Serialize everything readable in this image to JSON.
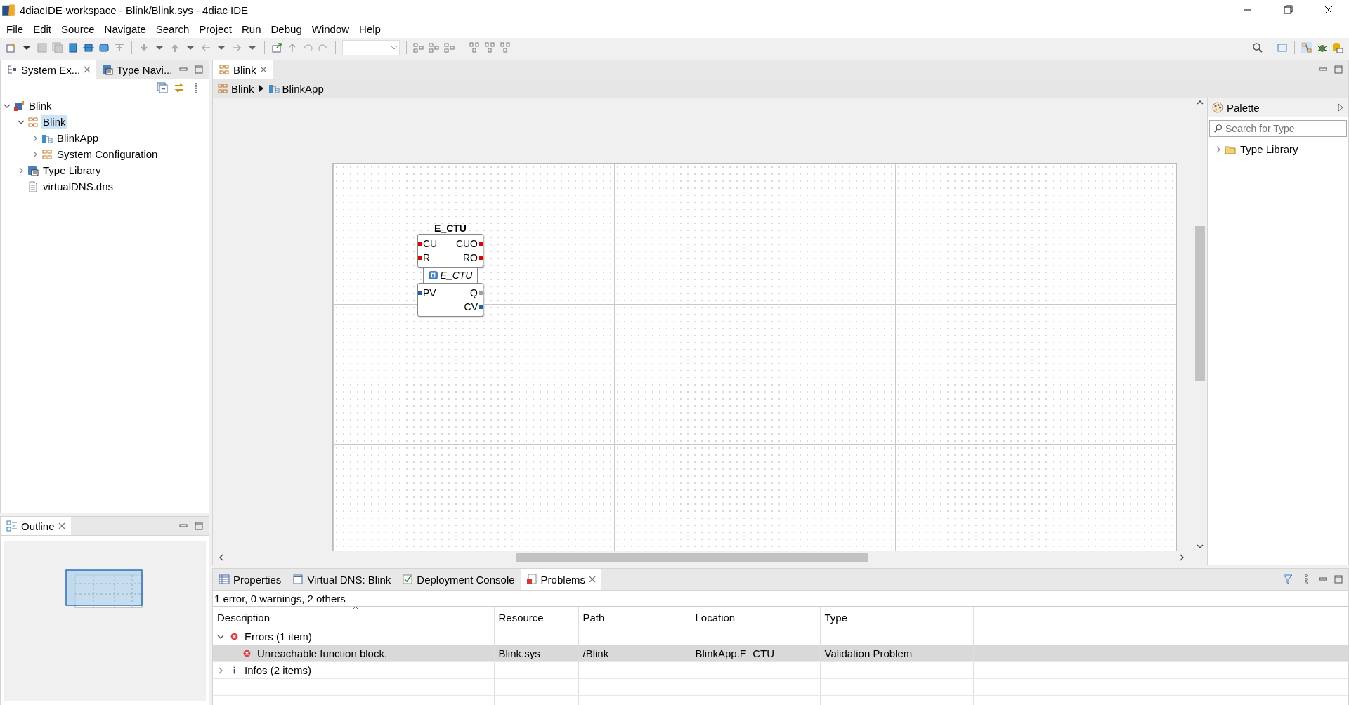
{
  "window": {
    "title": "4diacIDE-workspace - Blink/Blink.sys - 4diac IDE"
  },
  "menu": [
    "File",
    "Edit",
    "Source",
    "Navigate",
    "Search",
    "Project",
    "Run",
    "Debug",
    "Window",
    "Help"
  ],
  "left_tabs": [
    {
      "label": "System Ex...",
      "selected": true,
      "closable": true
    },
    {
      "label": "Type Navi...",
      "selected": false,
      "closable": false
    }
  ],
  "tree": [
    {
      "label": "Blink",
      "kind": "project",
      "expanded": true,
      "selected": false,
      "children": [
        {
          "label": "Blink",
          "kind": "system",
          "expanded": true,
          "selected": true,
          "children": [
            {
              "label": "BlinkApp",
              "kind": "application",
              "expanded": false,
              "selected": false
            },
            {
              "label": "System Configuration",
              "kind": "configuration",
              "expanded": false,
              "selected": false
            }
          ]
        },
        {
          "label": "Type Library",
          "kind": "library",
          "expanded": false,
          "selected": false
        },
        {
          "label": "virtualDNS.dns",
          "kind": "file",
          "selected": false
        }
      ]
    }
  ],
  "outline": {
    "tab": "Outline"
  },
  "editor": {
    "tab": "Blink",
    "breadcrumb": [
      {
        "label": "Blink",
        "kind": "system"
      },
      {
        "label": "BlinkApp",
        "kind": "application"
      }
    ],
    "block": {
      "name": "E_CTU",
      "type": "E_CTU",
      "event_inputs": [
        "CU",
        "R"
      ],
      "event_outputs": [
        "CUO",
        "RO"
      ],
      "data_inputs": [
        {
          "name": "PV",
          "color": "#1f5fa8"
        }
      ],
      "data_outputs": [
        {
          "name": "Q",
          "color": "#a0a08c"
        },
        {
          "name": "CV",
          "color": "#1f5fa8"
        }
      ]
    }
  },
  "palette": {
    "title": "Palette",
    "placeholder": "Search for Type",
    "items": [
      {
        "label": "Type Library",
        "expanded": false
      }
    ]
  },
  "bottom": {
    "tabs": [
      {
        "label": "Properties",
        "selected": false
      },
      {
        "label": "Virtual DNS: Blink",
        "selected": false
      },
      {
        "label": "Deployment Console",
        "selected": false
      },
      {
        "label": "Problems",
        "selected": true
      }
    ],
    "summary": "1 error, 0 warnings, 2 others",
    "columns": [
      "Description",
      "Resource",
      "Path",
      "Location",
      "Type"
    ],
    "rows": [
      {
        "kind": "errors",
        "expanded": true,
        "selected": false,
        "cells": [
          "Errors (1 item)"
        ]
      },
      {
        "kind": "error",
        "selected": true,
        "cells": [
          "Unreachable function block.",
          "Blink.sys",
          "/Blink",
          "BlinkApp.E_CTU",
          "Validation Problem"
        ]
      },
      {
        "kind": "infos",
        "expanded": false,
        "selected": false,
        "cells": [
          "Infos (2 items)"
        ]
      }
    ]
  }
}
